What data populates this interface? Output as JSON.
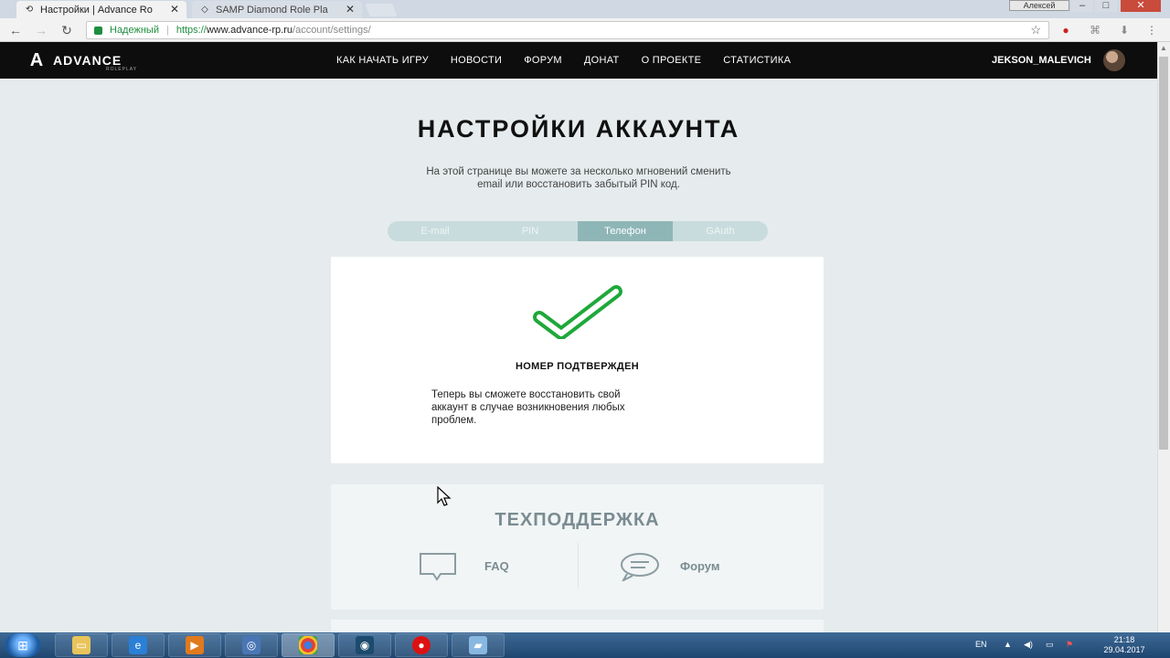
{
  "browser": {
    "tabs": [
      {
        "label": "Настройки | Advance Ro",
        "active": true
      },
      {
        "label": "SAMP Diamond Role Pla",
        "active": false
      }
    ],
    "profile_name": "Алексей",
    "secure_label": "Надежный",
    "url_scheme": "https://",
    "url_host": "www.advance-rp.ru",
    "url_path": "/account/settings/"
  },
  "site": {
    "logo_text": "ADVANCE",
    "logo_sub": "ROLEPLAY",
    "nav": [
      "КАК НАЧАТЬ ИГРУ",
      "НОВОСТИ",
      "ФОРУМ",
      "ДОНАТ",
      "О ПРОЕКТЕ",
      "СТАТИСТИКА"
    ],
    "username": "JEKSON_MALEVICH"
  },
  "page": {
    "title": "НАСТРОЙКИ АККАУНТА",
    "description_line1": "На этой странице вы можете за несколько мгновений сменить",
    "description_line2": "email или восстановить забытый PIN код.",
    "tabs": [
      {
        "label": "E-mail",
        "selected": false
      },
      {
        "label": "PIN",
        "selected": false
      },
      {
        "label": "Телефон",
        "selected": true
      },
      {
        "label": "GAuth",
        "selected": false
      }
    ],
    "status_title": "НОМЕР ПОДТВЕРЖДЕН",
    "status_text_line1": "Теперь вы сможете восстановить свой",
    "status_text_line2": "аккаунт в случае возникновения любых",
    "status_text_line3": "проблем.",
    "support_title": "ТЕХПОДДЕРЖКА",
    "support_links": [
      "FAQ",
      "Форум"
    ]
  },
  "taskbar": {
    "language": "EN",
    "time": "21:18",
    "date": "29.04.2017"
  },
  "colors": {
    "accent_green": "#1ea83a",
    "tab_selected": "#8fb6b7",
    "nav_bg": "#0d0d0d"
  }
}
